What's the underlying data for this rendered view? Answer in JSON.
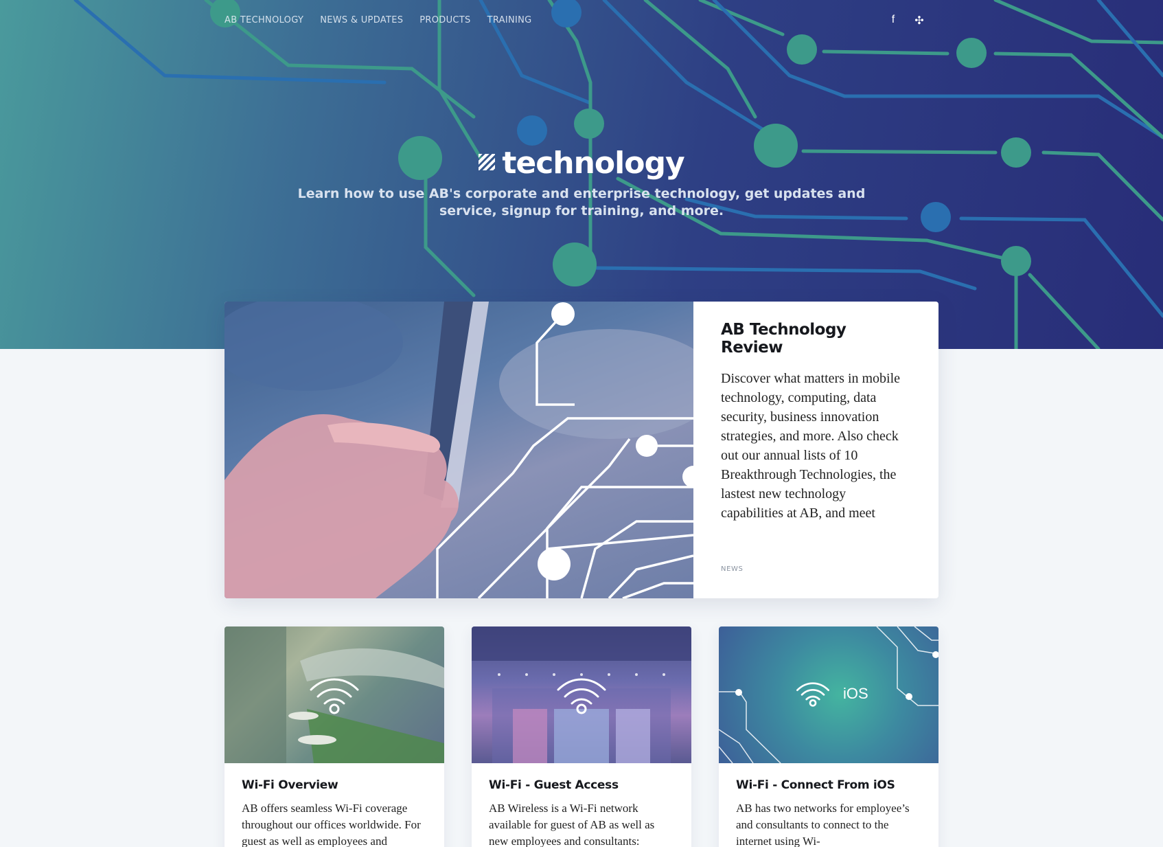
{
  "nav": {
    "items": [
      {
        "label": "AB TECHNOLOGY"
      },
      {
        "label": "NEWS & UPDATES"
      },
      {
        "label": "PRODUCTS"
      },
      {
        "label": "TRAINING"
      }
    ]
  },
  "social": {
    "facebook_glyph": "f",
    "yammer_glyph": "✣",
    "facebook_icon": "facebook-icon",
    "yammer_icon": "yammer-icon"
  },
  "hero": {
    "title": "technology",
    "subtitle": "Learn how to use AB's corporate and enterprise technology, get updates and service, signup for training, and more."
  },
  "feature": {
    "title": "AB Technology Review",
    "text": "Discover what matters in mobile technology, computing, data security, business innovation strategies, and more. Also check out our annual lists of 10 Breakthrough Technologies, the lastest new technology capabilities at AB, and meet",
    "tag": "NEWS"
  },
  "cards": [
    {
      "title": "Wi-Fi Overview",
      "text": "AB offers seamless Wi-Fi coverage throughout our offices worldwide. For guest as well as employees and"
    },
    {
      "title": "Wi-Fi - Guest Access",
      "text": "AB Wireless is a Wi-Fi network available for guest of AB as well as new employees and consultants:"
    },
    {
      "title": "Wi-Fi - Connect From iOS",
      "text": "AB has two networks for employee’s and consultants to connect to the internet using Wi-",
      "thumb_label": "iOS"
    }
  ],
  "colors": {
    "hero_start": "#4a9a9c",
    "hero_end": "#282d78",
    "circuit_green": "#3d9a8a",
    "circuit_blue": "#2a6fb0"
  }
}
